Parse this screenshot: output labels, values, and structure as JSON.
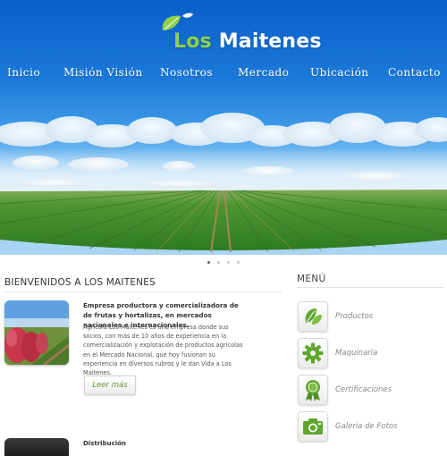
{
  "logo": {
    "text_first": "Los",
    "text_rest": "Maitenes"
  },
  "nav": {
    "items": [
      {
        "label": "Inicio"
      },
      {
        "label": "Misión Visión"
      },
      {
        "label": "Nosotros"
      },
      {
        "label": "Mercado"
      },
      {
        "label": "Ubicación"
      },
      {
        "label": "Contacto"
      }
    ]
  },
  "slider": {
    "dot_count": 4,
    "active_index": 0
  },
  "welcome": {
    "title": "BIENVENIDOS A LOS MAITENES",
    "intro_bold": "Empresa productora y comercializadora de de frutas y hortalizas, en mercados nacionales e internacionales.",
    "intro_body": "Agrícola Los Maitenes es una empresa donde sus socios, con más de 10 años de experiencia en la comercialización y explotación de productos agrícolas en el Mercado Nacional, que hoy fusionan su experiencia en diversos rubros y le dan Vida a Los Maitenes.",
    "more_button": "Leer más",
    "second_title": "Distribución"
  },
  "menu": {
    "title": "MENÚ",
    "items": [
      {
        "label": "Productos",
        "icon": "leaves-icon"
      },
      {
        "label": "Maquinaria",
        "icon": "gear-icon"
      },
      {
        "label": "Certificaciones",
        "icon": "award-ribbon-icon"
      },
      {
        "label": "Galeria de Fotos",
        "icon": "camera-icon"
      }
    ],
    "icon_color": "#5ea62c"
  },
  "colors": {
    "sky": "#1b78d8",
    "field": "#3f8a2a",
    "accent_green": "#5ea62c"
  }
}
